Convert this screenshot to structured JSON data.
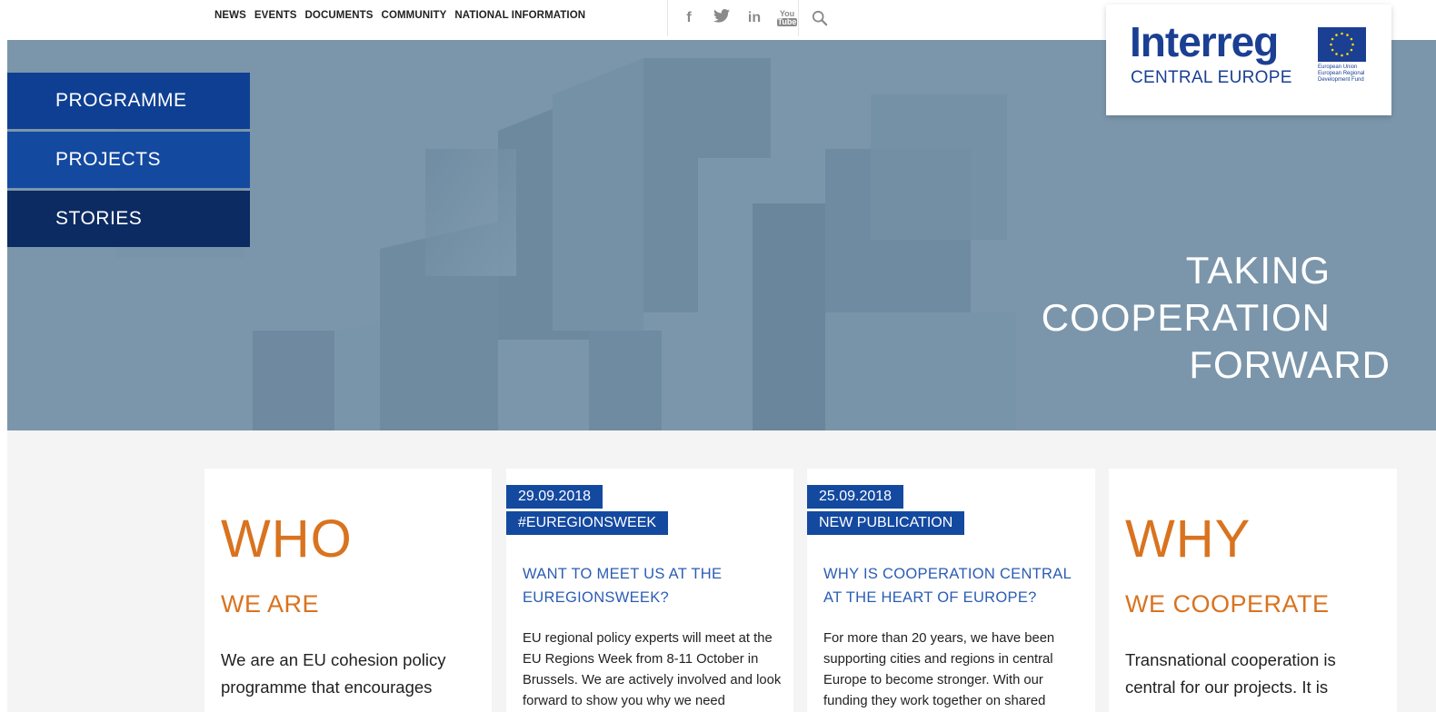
{
  "topnav": [
    "NEWS",
    "EVENTS",
    "DOCUMENTS",
    "COMMUNITY",
    "NATIONAL INFORMATION"
  ],
  "social": {
    "facebook": "f",
    "twitter": "twitter-bird",
    "linkedin": "in",
    "youtube_top": "You",
    "youtube_bottom": "Tube"
  },
  "logo": {
    "word": "Interreg",
    "sub": "CENTRAL EUROPE",
    "eu_line1": "European Union",
    "eu_line2": "European Regional",
    "eu_line3": "Development Fund"
  },
  "sidenav": [
    "PROGRAMME",
    "PROJECTS",
    "STORIES"
  ],
  "tagline": [
    "TAKING",
    "COOPERATION",
    "FORWARD"
  ],
  "colors": {
    "brand_blue": "#1449a0",
    "dark_blue": "#0c2b62",
    "orange": "#d9731f",
    "hero_bg": "#7d98ad"
  },
  "cards": {
    "who": {
      "big": "WHO",
      "sub": "WE ARE",
      "text": "We are an EU cohesion policy programme that encourages"
    },
    "news1": {
      "date": "29.09.2018",
      "category": "#EUREGIONSWEEK",
      "title": "WANT TO MEET US AT THE EUREGIONSWEEK?",
      "text": "EU regional policy experts will meet at the EU Regions Week from 8-11 October in Brussels. We are actively involved and look forward to show you why we need"
    },
    "news2": {
      "date": "25.09.2018",
      "category": "NEW PUBLICATION",
      "title": "WHY IS COOPERATION CENTRAL AT THE HEART OF EUROPE?",
      "text": "For more than 20 years, we have been supporting cities and regions in central Europe to become stronger. With our funding they work together on shared"
    },
    "why": {
      "big": "WHY",
      "sub": "WE COOPERATE",
      "text": "Transnational cooperation is central for our projects. It is"
    }
  }
}
